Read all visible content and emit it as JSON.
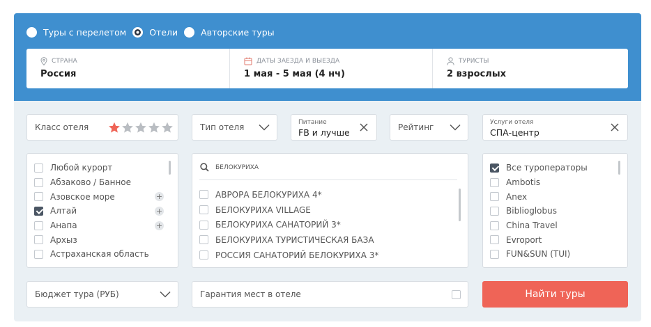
{
  "tour_types": [
    {
      "label": "Туры с перелетом",
      "selected": false
    },
    {
      "label": "Отели",
      "selected": true
    },
    {
      "label": "Авторские туры",
      "selected": false
    }
  ],
  "search": {
    "country": {
      "label": "СТРАНА",
      "value": "Россия",
      "icon": "location-pin-icon"
    },
    "dates": {
      "label": "ДАТЫ ЗАЕЗДА И ВЫЕЗДА",
      "value": "1 мая - 5 мая (4 нч)",
      "icon": "calendar-icon"
    },
    "tourists": {
      "label": "ТУРИСТЫ",
      "value": "2 взрослых",
      "icon": "person-icon"
    }
  },
  "filters": {
    "hotel_class": {
      "label": "Класс отеля",
      "stars_total": 5,
      "stars_selected": 1
    },
    "hotel_type": {
      "label": "Тип отеля"
    },
    "meal": {
      "small_label": "Питание",
      "value": "FB и лучше"
    },
    "rating": {
      "label": "Рейтинг"
    },
    "services": {
      "small_label": "Услуги отеля",
      "value": "СПА-центр"
    }
  },
  "resorts": [
    {
      "label": "Любой курорт",
      "checked": false,
      "expandable": false
    },
    {
      "label": "Абзаково / Банное",
      "checked": false,
      "expandable": false
    },
    {
      "label": "Азовское море",
      "checked": false,
      "expandable": true
    },
    {
      "label": "Алтай",
      "checked": true,
      "expandable": true
    },
    {
      "label": "Анапа",
      "checked": false,
      "expandable": true
    },
    {
      "label": "Архыз",
      "checked": false,
      "expandable": false
    },
    {
      "label": "Астраханская область",
      "checked": false,
      "expandable": false
    }
  ],
  "hotel_search": {
    "query": "белокуриха",
    "hotels": [
      {
        "label": "АВРОРА БЕЛОКУРИХА 4*",
        "checked": false
      },
      {
        "label": "БЕЛОКУРИХА VILLAGE",
        "checked": false
      },
      {
        "label": "БЕЛОКУРИХА САНАТОРИЙ 3*",
        "checked": false
      },
      {
        "label": "БЕЛОКУРИХА ТУРИСТИЧЕСКАЯ БАЗА",
        "checked": false
      },
      {
        "label": "РОССИЯ САНАТОРИЙ БЕЛОКУРИХА 3*",
        "checked": false
      }
    ]
  },
  "operators": [
    {
      "label": "Все туроператоры",
      "checked": true
    },
    {
      "label": "Ambotis",
      "checked": false
    },
    {
      "label": "Anex",
      "checked": false
    },
    {
      "label": "Biblioglobus",
      "checked": false
    },
    {
      "label": "China Travel",
      "checked": false
    },
    {
      "label": "Evroport",
      "checked": false
    },
    {
      "label": "FUN&SUN (TUI)",
      "checked": false
    }
  ],
  "budget": {
    "label": "Бюджет тура (РУБ)"
  },
  "guarantee": {
    "label": "Гарантия мест в отеле",
    "checked": false
  },
  "submit": {
    "label": "Найти туры"
  },
  "colors": {
    "header": "#3f8fcf",
    "accent": "#ef6457",
    "star_active": "#ef6457",
    "star_inactive": "#b9bdc2",
    "panel_bg": "#eaf0f4"
  }
}
